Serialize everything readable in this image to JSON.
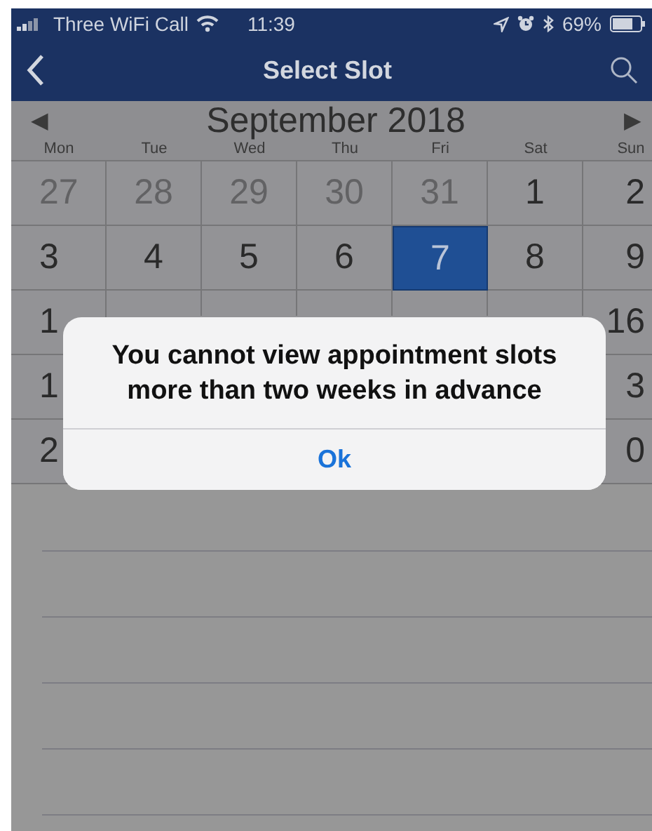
{
  "status_bar": {
    "carrier": "Three WiFi Call",
    "time": "11:39",
    "battery": "69%"
  },
  "nav_bar": {
    "title": "Select Slot"
  },
  "calendar": {
    "prev": "◀",
    "month": "September 2018",
    "next": "▶",
    "weekdays": [
      "Mon",
      "Tue",
      "Wed",
      "Thu",
      "Fri",
      "Sat",
      "Sun"
    ],
    "weeks": [
      {
        "kind": "full",
        "days": [
          {
            "day": "27",
            "in_month": false,
            "selected": false
          },
          {
            "day": "28",
            "in_month": false,
            "selected": false
          },
          {
            "day": "29",
            "in_month": false,
            "selected": false
          },
          {
            "day": "30",
            "in_month": false,
            "selected": false
          },
          {
            "day": "31",
            "in_month": false,
            "selected": false
          },
          {
            "day": "1",
            "in_month": true,
            "selected": false
          },
          {
            "day": "2",
            "in_month": true,
            "selected": false
          }
        ]
      },
      {
        "kind": "full",
        "days": [
          {
            "day": "3",
            "in_month": true,
            "selected": false
          },
          {
            "day": "4",
            "in_month": true,
            "selected": false
          },
          {
            "day": "5",
            "in_month": true,
            "selected": false
          },
          {
            "day": "6",
            "in_month": true,
            "selected": false
          },
          {
            "day": "7",
            "in_month": true,
            "selected": true
          },
          {
            "day": "8",
            "in_month": true,
            "selected": false
          },
          {
            "day": "9",
            "in_month": true,
            "selected": false
          }
        ]
      },
      {
        "kind": "covered",
        "first": {
          "day": "1",
          "in_month": true,
          "selected": false
        },
        "last": {
          "day": "16",
          "in_month": true,
          "selected": false
        }
      },
      {
        "kind": "covered",
        "first": {
          "day": "1",
          "in_month": true,
          "selected": false
        },
        "last": {
          "day": "3",
          "in_month": true,
          "selected": false
        }
      },
      {
        "kind": "covered",
        "first": {
          "day": "2",
          "in_month": true,
          "selected": false
        },
        "last": {
          "day": "0",
          "in_month": true,
          "selected": false
        }
      }
    ]
  },
  "alert": {
    "message": "You cannot view appointment slots more than two weeks in advance",
    "button": "Ok"
  }
}
